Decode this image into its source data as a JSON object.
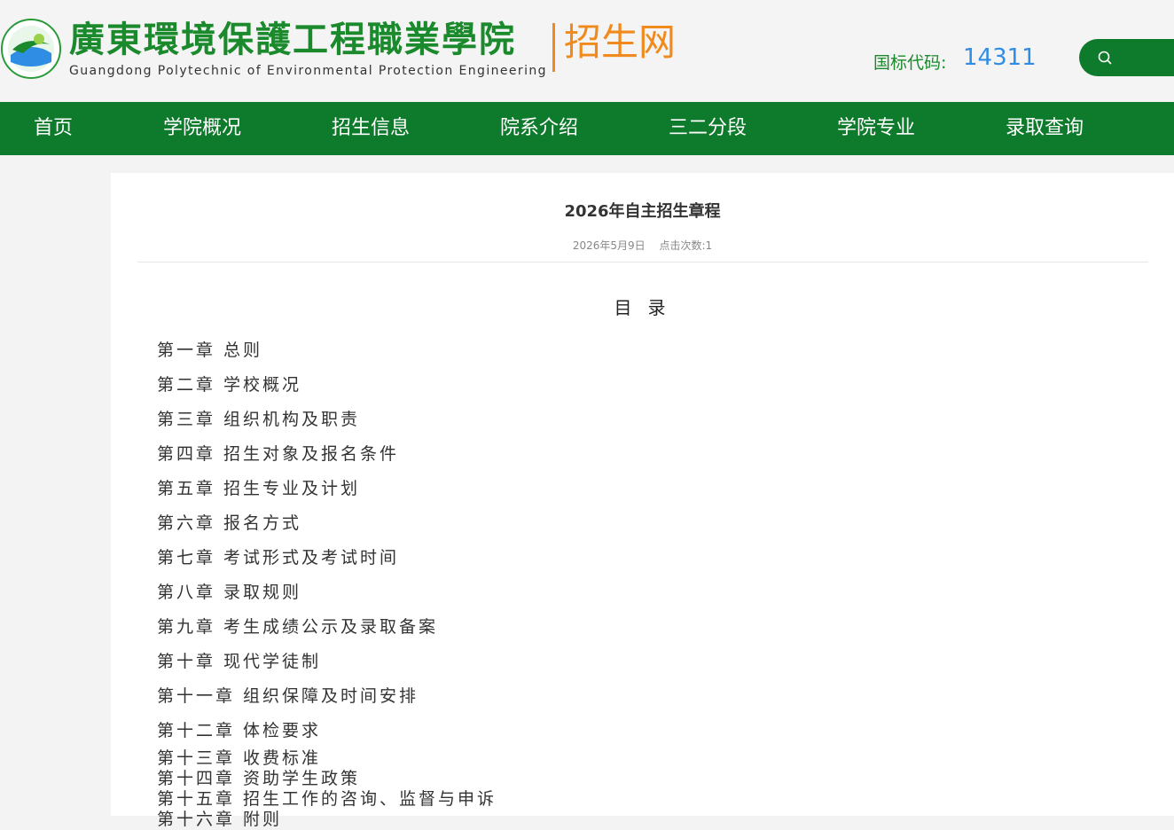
{
  "header": {
    "school_name_cn": "廣東環境保護工程職業學院",
    "school_name_en": "Guangdong Polytechnic of Environmental Protection Engineering",
    "site_name": "招生网",
    "code_label": "国标代码:",
    "code_value": "14311",
    "search_icon": "search-icon"
  },
  "nav": {
    "items": [
      {
        "label": "首页"
      },
      {
        "label": "学院概况"
      },
      {
        "label": "招生信息"
      },
      {
        "label": "院系介绍"
      },
      {
        "label": "三二分段"
      },
      {
        "label": "学院专业"
      },
      {
        "label": "录取查询"
      }
    ]
  },
  "article": {
    "title": "2026年自主招生章程",
    "date": "2026年5月9日",
    "hits": "点击次数:1",
    "toc_heading": "目录",
    "toc": [
      "第一章 总则",
      "第二章 学校概况",
      "第三章 组织机构及职责",
      "第四章 招生对象及报名条件",
      "第五章 招生专业及计划",
      "第六章 报名方式",
      "第七章 考试形式及考试时间",
      "第八章 录取规则",
      "第九章 考生成绩公示及录取备案",
      "第十章 现代学徒制",
      "第十一章 组织保障及时间安排",
      "第十二章 体检要求",
      "第十三章 收费标准",
      "第十四章 资助学生政策",
      "第十五章 招生工作的咨询、监督与申诉",
      "第十六章 附则"
    ]
  },
  "colors": {
    "brand_green": "#0e7a2b",
    "logo_green": "#1b8a2c",
    "accent_orange": "#f08a1c",
    "code_blue": "#2f8de4"
  }
}
